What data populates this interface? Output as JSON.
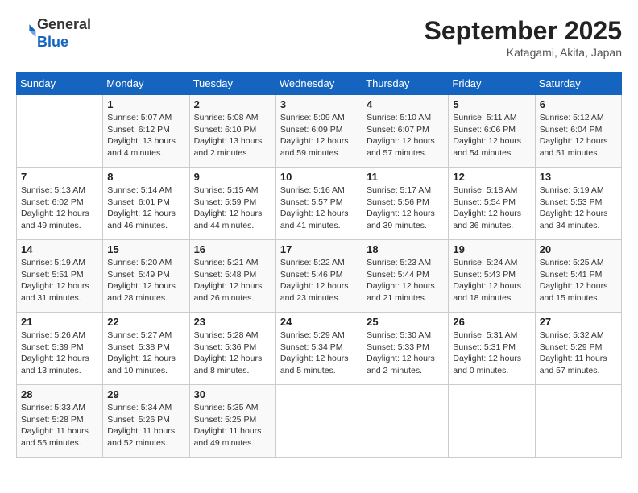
{
  "header": {
    "logo_line1": "General",
    "logo_line2": "Blue",
    "month": "September 2025",
    "location": "Katagami, Akita, Japan"
  },
  "weekdays": [
    "Sunday",
    "Monday",
    "Tuesday",
    "Wednesday",
    "Thursday",
    "Friday",
    "Saturday"
  ],
  "weeks": [
    [
      {
        "day": "",
        "info": ""
      },
      {
        "day": "1",
        "info": "Sunrise: 5:07 AM\nSunset: 6:12 PM\nDaylight: 13 hours\nand 4 minutes."
      },
      {
        "day": "2",
        "info": "Sunrise: 5:08 AM\nSunset: 6:10 PM\nDaylight: 13 hours\nand 2 minutes."
      },
      {
        "day": "3",
        "info": "Sunrise: 5:09 AM\nSunset: 6:09 PM\nDaylight: 12 hours\nand 59 minutes."
      },
      {
        "day": "4",
        "info": "Sunrise: 5:10 AM\nSunset: 6:07 PM\nDaylight: 12 hours\nand 57 minutes."
      },
      {
        "day": "5",
        "info": "Sunrise: 5:11 AM\nSunset: 6:06 PM\nDaylight: 12 hours\nand 54 minutes."
      },
      {
        "day": "6",
        "info": "Sunrise: 5:12 AM\nSunset: 6:04 PM\nDaylight: 12 hours\nand 51 minutes."
      }
    ],
    [
      {
        "day": "7",
        "info": "Sunrise: 5:13 AM\nSunset: 6:02 PM\nDaylight: 12 hours\nand 49 minutes."
      },
      {
        "day": "8",
        "info": "Sunrise: 5:14 AM\nSunset: 6:01 PM\nDaylight: 12 hours\nand 46 minutes."
      },
      {
        "day": "9",
        "info": "Sunrise: 5:15 AM\nSunset: 5:59 PM\nDaylight: 12 hours\nand 44 minutes."
      },
      {
        "day": "10",
        "info": "Sunrise: 5:16 AM\nSunset: 5:57 PM\nDaylight: 12 hours\nand 41 minutes."
      },
      {
        "day": "11",
        "info": "Sunrise: 5:17 AM\nSunset: 5:56 PM\nDaylight: 12 hours\nand 39 minutes."
      },
      {
        "day": "12",
        "info": "Sunrise: 5:18 AM\nSunset: 5:54 PM\nDaylight: 12 hours\nand 36 minutes."
      },
      {
        "day": "13",
        "info": "Sunrise: 5:19 AM\nSunset: 5:53 PM\nDaylight: 12 hours\nand 34 minutes."
      }
    ],
    [
      {
        "day": "14",
        "info": "Sunrise: 5:19 AM\nSunset: 5:51 PM\nDaylight: 12 hours\nand 31 minutes."
      },
      {
        "day": "15",
        "info": "Sunrise: 5:20 AM\nSunset: 5:49 PM\nDaylight: 12 hours\nand 28 minutes."
      },
      {
        "day": "16",
        "info": "Sunrise: 5:21 AM\nSunset: 5:48 PM\nDaylight: 12 hours\nand 26 minutes."
      },
      {
        "day": "17",
        "info": "Sunrise: 5:22 AM\nSunset: 5:46 PM\nDaylight: 12 hours\nand 23 minutes."
      },
      {
        "day": "18",
        "info": "Sunrise: 5:23 AM\nSunset: 5:44 PM\nDaylight: 12 hours\nand 21 minutes."
      },
      {
        "day": "19",
        "info": "Sunrise: 5:24 AM\nSunset: 5:43 PM\nDaylight: 12 hours\nand 18 minutes."
      },
      {
        "day": "20",
        "info": "Sunrise: 5:25 AM\nSunset: 5:41 PM\nDaylight: 12 hours\nand 15 minutes."
      }
    ],
    [
      {
        "day": "21",
        "info": "Sunrise: 5:26 AM\nSunset: 5:39 PM\nDaylight: 12 hours\nand 13 minutes."
      },
      {
        "day": "22",
        "info": "Sunrise: 5:27 AM\nSunset: 5:38 PM\nDaylight: 12 hours\nand 10 minutes."
      },
      {
        "day": "23",
        "info": "Sunrise: 5:28 AM\nSunset: 5:36 PM\nDaylight: 12 hours\nand 8 minutes."
      },
      {
        "day": "24",
        "info": "Sunrise: 5:29 AM\nSunset: 5:34 PM\nDaylight: 12 hours\nand 5 minutes."
      },
      {
        "day": "25",
        "info": "Sunrise: 5:30 AM\nSunset: 5:33 PM\nDaylight: 12 hours\nand 2 minutes."
      },
      {
        "day": "26",
        "info": "Sunrise: 5:31 AM\nSunset: 5:31 PM\nDaylight: 12 hours\nand 0 minutes."
      },
      {
        "day": "27",
        "info": "Sunrise: 5:32 AM\nSunset: 5:29 PM\nDaylight: 11 hours\nand 57 minutes."
      }
    ],
    [
      {
        "day": "28",
        "info": "Sunrise: 5:33 AM\nSunset: 5:28 PM\nDaylight: 11 hours\nand 55 minutes."
      },
      {
        "day": "29",
        "info": "Sunrise: 5:34 AM\nSunset: 5:26 PM\nDaylight: 11 hours\nand 52 minutes."
      },
      {
        "day": "30",
        "info": "Sunrise: 5:35 AM\nSunset: 5:25 PM\nDaylight: 11 hours\nand 49 minutes."
      },
      {
        "day": "",
        "info": ""
      },
      {
        "day": "",
        "info": ""
      },
      {
        "day": "",
        "info": ""
      },
      {
        "day": "",
        "info": ""
      }
    ]
  ]
}
